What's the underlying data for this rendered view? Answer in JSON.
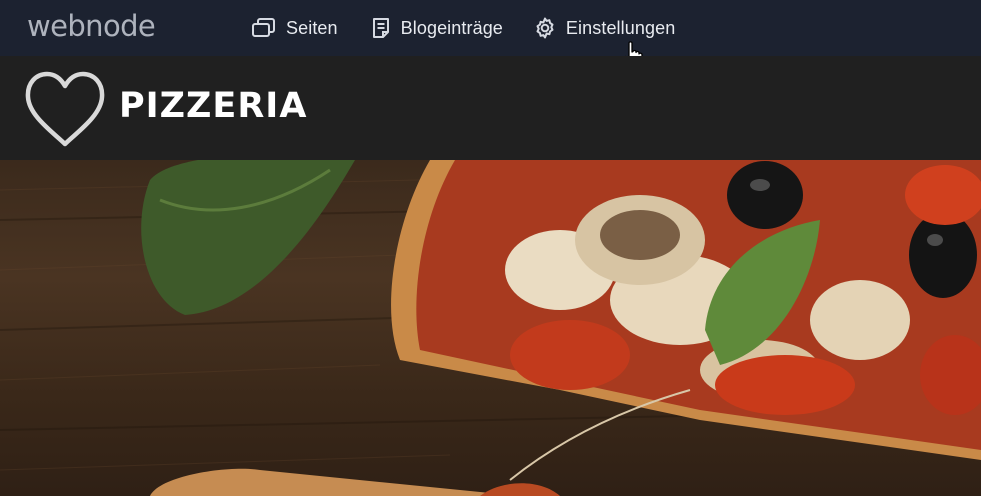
{
  "editor": {
    "brand": "webnode",
    "nav": [
      {
        "label": "Seiten",
        "icon": "pages-icon"
      },
      {
        "label": "Blogeinträge",
        "icon": "blog-entries-icon"
      },
      {
        "label": "Einstellungen",
        "icon": "gear-icon"
      }
    ]
  },
  "site": {
    "title": "PIZZERIA",
    "logo_icon": "heart-logo-icon"
  },
  "hero": {
    "image": "pizza-on-wooden-board"
  },
  "colors": {
    "topbar": "#1c2230",
    "header": "#202020",
    "text_light": "#e8ebf0"
  }
}
